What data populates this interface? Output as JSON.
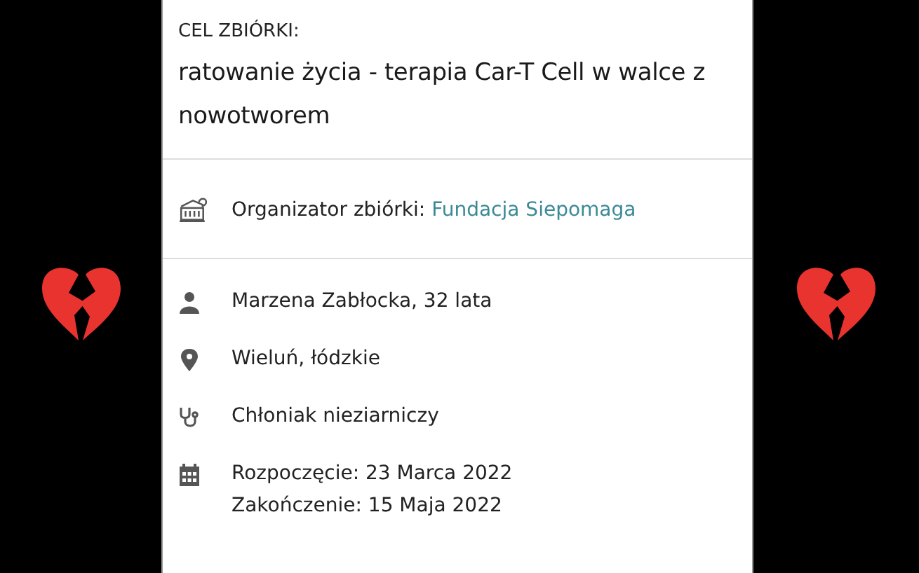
{
  "goal": {
    "label": "CEL ZBIÓRKI:",
    "text": "ratowanie życia - terapia Car-T Cell w walce z nowotworem"
  },
  "organizer": {
    "label": "Organizator zbiórki:",
    "link": "Fundacja Siepomaga"
  },
  "details": [
    {
      "kind": "person",
      "lines": [
        "Marzena Zabłocka, 32 lata"
      ]
    },
    {
      "kind": "location",
      "lines": [
        "Wieluń, łódzkie"
      ]
    },
    {
      "kind": "diagnosis",
      "lines": [
        "Chłoniak nieziarniczy"
      ]
    },
    {
      "kind": "dates",
      "lines": [
        "Rozpoczęcie: 23 Marca 2022",
        "Zakończenie: 15 Maja 2022"
      ]
    }
  ]
}
